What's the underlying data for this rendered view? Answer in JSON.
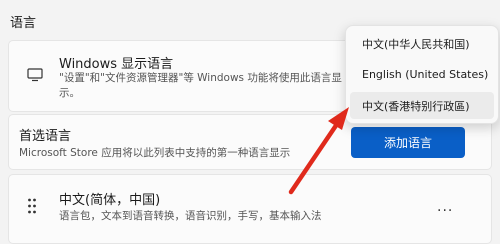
{
  "section": {
    "title": "语言"
  },
  "display_language": {
    "title": "Windows 显示语言",
    "description": "\"设置\"和\"文件资源管理器\"等 Windows 功能将使用此语言显示。"
  },
  "preferred_languages": {
    "title": "首选语言",
    "description": "Microsoft Store 应用将以此列表中支持的第一种语言显示",
    "add_button": "添加语言"
  },
  "language_item": {
    "title": "中文(简体，中国)",
    "features": "语言包，文本到语音转换，语音识别，手写，基本输入法",
    "more_label": "..."
  },
  "dropdown": {
    "options": [
      "中文(中华人民共和国)",
      "English (United States)",
      "中文(香港特别行政區)"
    ],
    "highlighted_index": 2
  },
  "colors": {
    "accent": "#0a5fc7",
    "arrow": "#e02a1c"
  }
}
